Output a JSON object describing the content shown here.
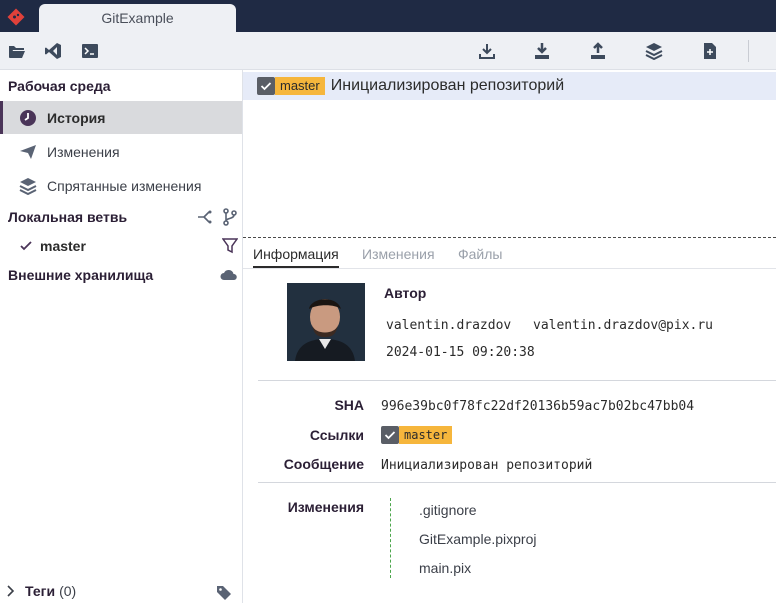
{
  "window": {
    "tab_title": "GitExample"
  },
  "toolbar": {
    "left_icons": [
      "folder-open-icon",
      "visual-studio-icon",
      "terminal-icon"
    ],
    "right_icons": [
      "fetch-icon",
      "pull-icon",
      "push-icon",
      "stash-icon",
      "patch-icon"
    ]
  },
  "sidebar": {
    "workspace_title": "Рабочая среда",
    "items": [
      {
        "label": "История",
        "icon": "clock-icon",
        "active": true
      },
      {
        "label": "Изменения",
        "icon": "send-icon",
        "active": false
      },
      {
        "label": "Спрятанные изменения",
        "icon": "layers-icon",
        "active": false
      }
    ],
    "local_branch_title": "Локальная ветвь",
    "branch_name": "master",
    "remotes_title": "Внешние хранилища",
    "tags_label": "Теги",
    "tags_count": "(0)"
  },
  "commits": [
    {
      "branch": "master",
      "message": "Инициализирован репозиторий"
    }
  ],
  "details": {
    "tabs": [
      "Информация",
      "Изменения",
      "Файлы"
    ],
    "author_title": "Автор",
    "author_name": "valentin.drazdov",
    "author_email": "valentin.drazdov@pix.ru",
    "date": "2024-01-15 09:20:38",
    "sha_label": "SHA",
    "sha_value": "996e39bc0f78fc22df20136b59ac7b02bc47bb04",
    "refs_label": "Ссылки",
    "refs_value": "master",
    "message_label": "Сообщение",
    "message_value": "Инициализирован репозиторий",
    "changes_label": "Изменения",
    "files": [
      ".gitignore",
      "GitExample.pixproj",
      "main.pix"
    ]
  },
  "colors": {
    "titlebar": "#1f2a44",
    "accent": "#4a3458",
    "branch_tag": "#f6b63c",
    "selected_row": "#e6ebf8"
  }
}
